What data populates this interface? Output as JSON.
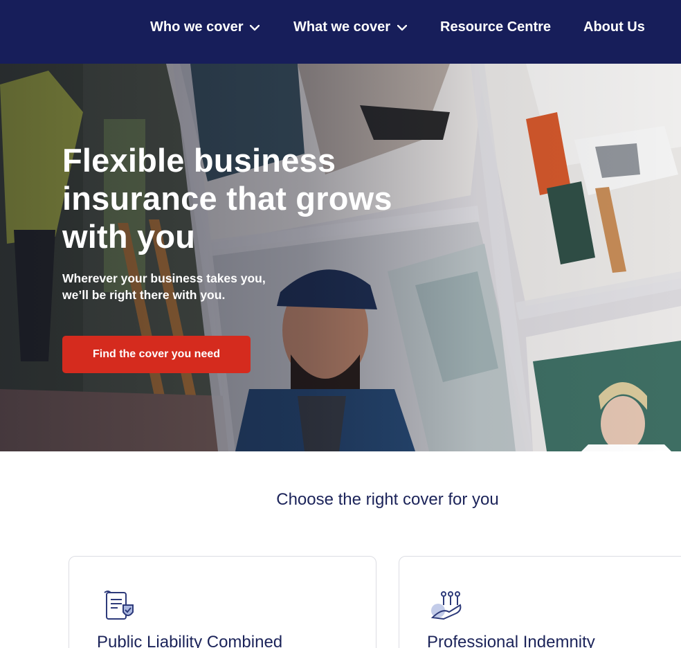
{
  "nav": {
    "items": [
      {
        "label": "Who we cover",
        "has_dropdown": true
      },
      {
        "label": "What we cover",
        "has_dropdown": true
      },
      {
        "label": "Resource Centre",
        "has_dropdown": false
      },
      {
        "label": "About Us",
        "has_dropdown": false
      }
    ],
    "background": "#171e5a"
  },
  "hero": {
    "title_lines": [
      "Flexible business",
      "insurance that grows",
      "with you"
    ],
    "subtitle_lines": [
      "Wherever your business takes you,",
      "we’ll be right there with you."
    ],
    "cta_label": "Find the cover you need",
    "cta_color": "#d52b1e"
  },
  "cover_section": {
    "title": "Choose the right cover for you",
    "cards": [
      {
        "title": "Public Liability Combined",
        "icon": "document-shield-icon"
      },
      {
        "title": "Professional Indemnity",
        "icon": "hand-people-icon"
      }
    ]
  },
  "colors": {
    "brand_navy": "#171e5a",
    "cta_red": "#d52b1e",
    "heading_navy": "#1b2359"
  }
}
